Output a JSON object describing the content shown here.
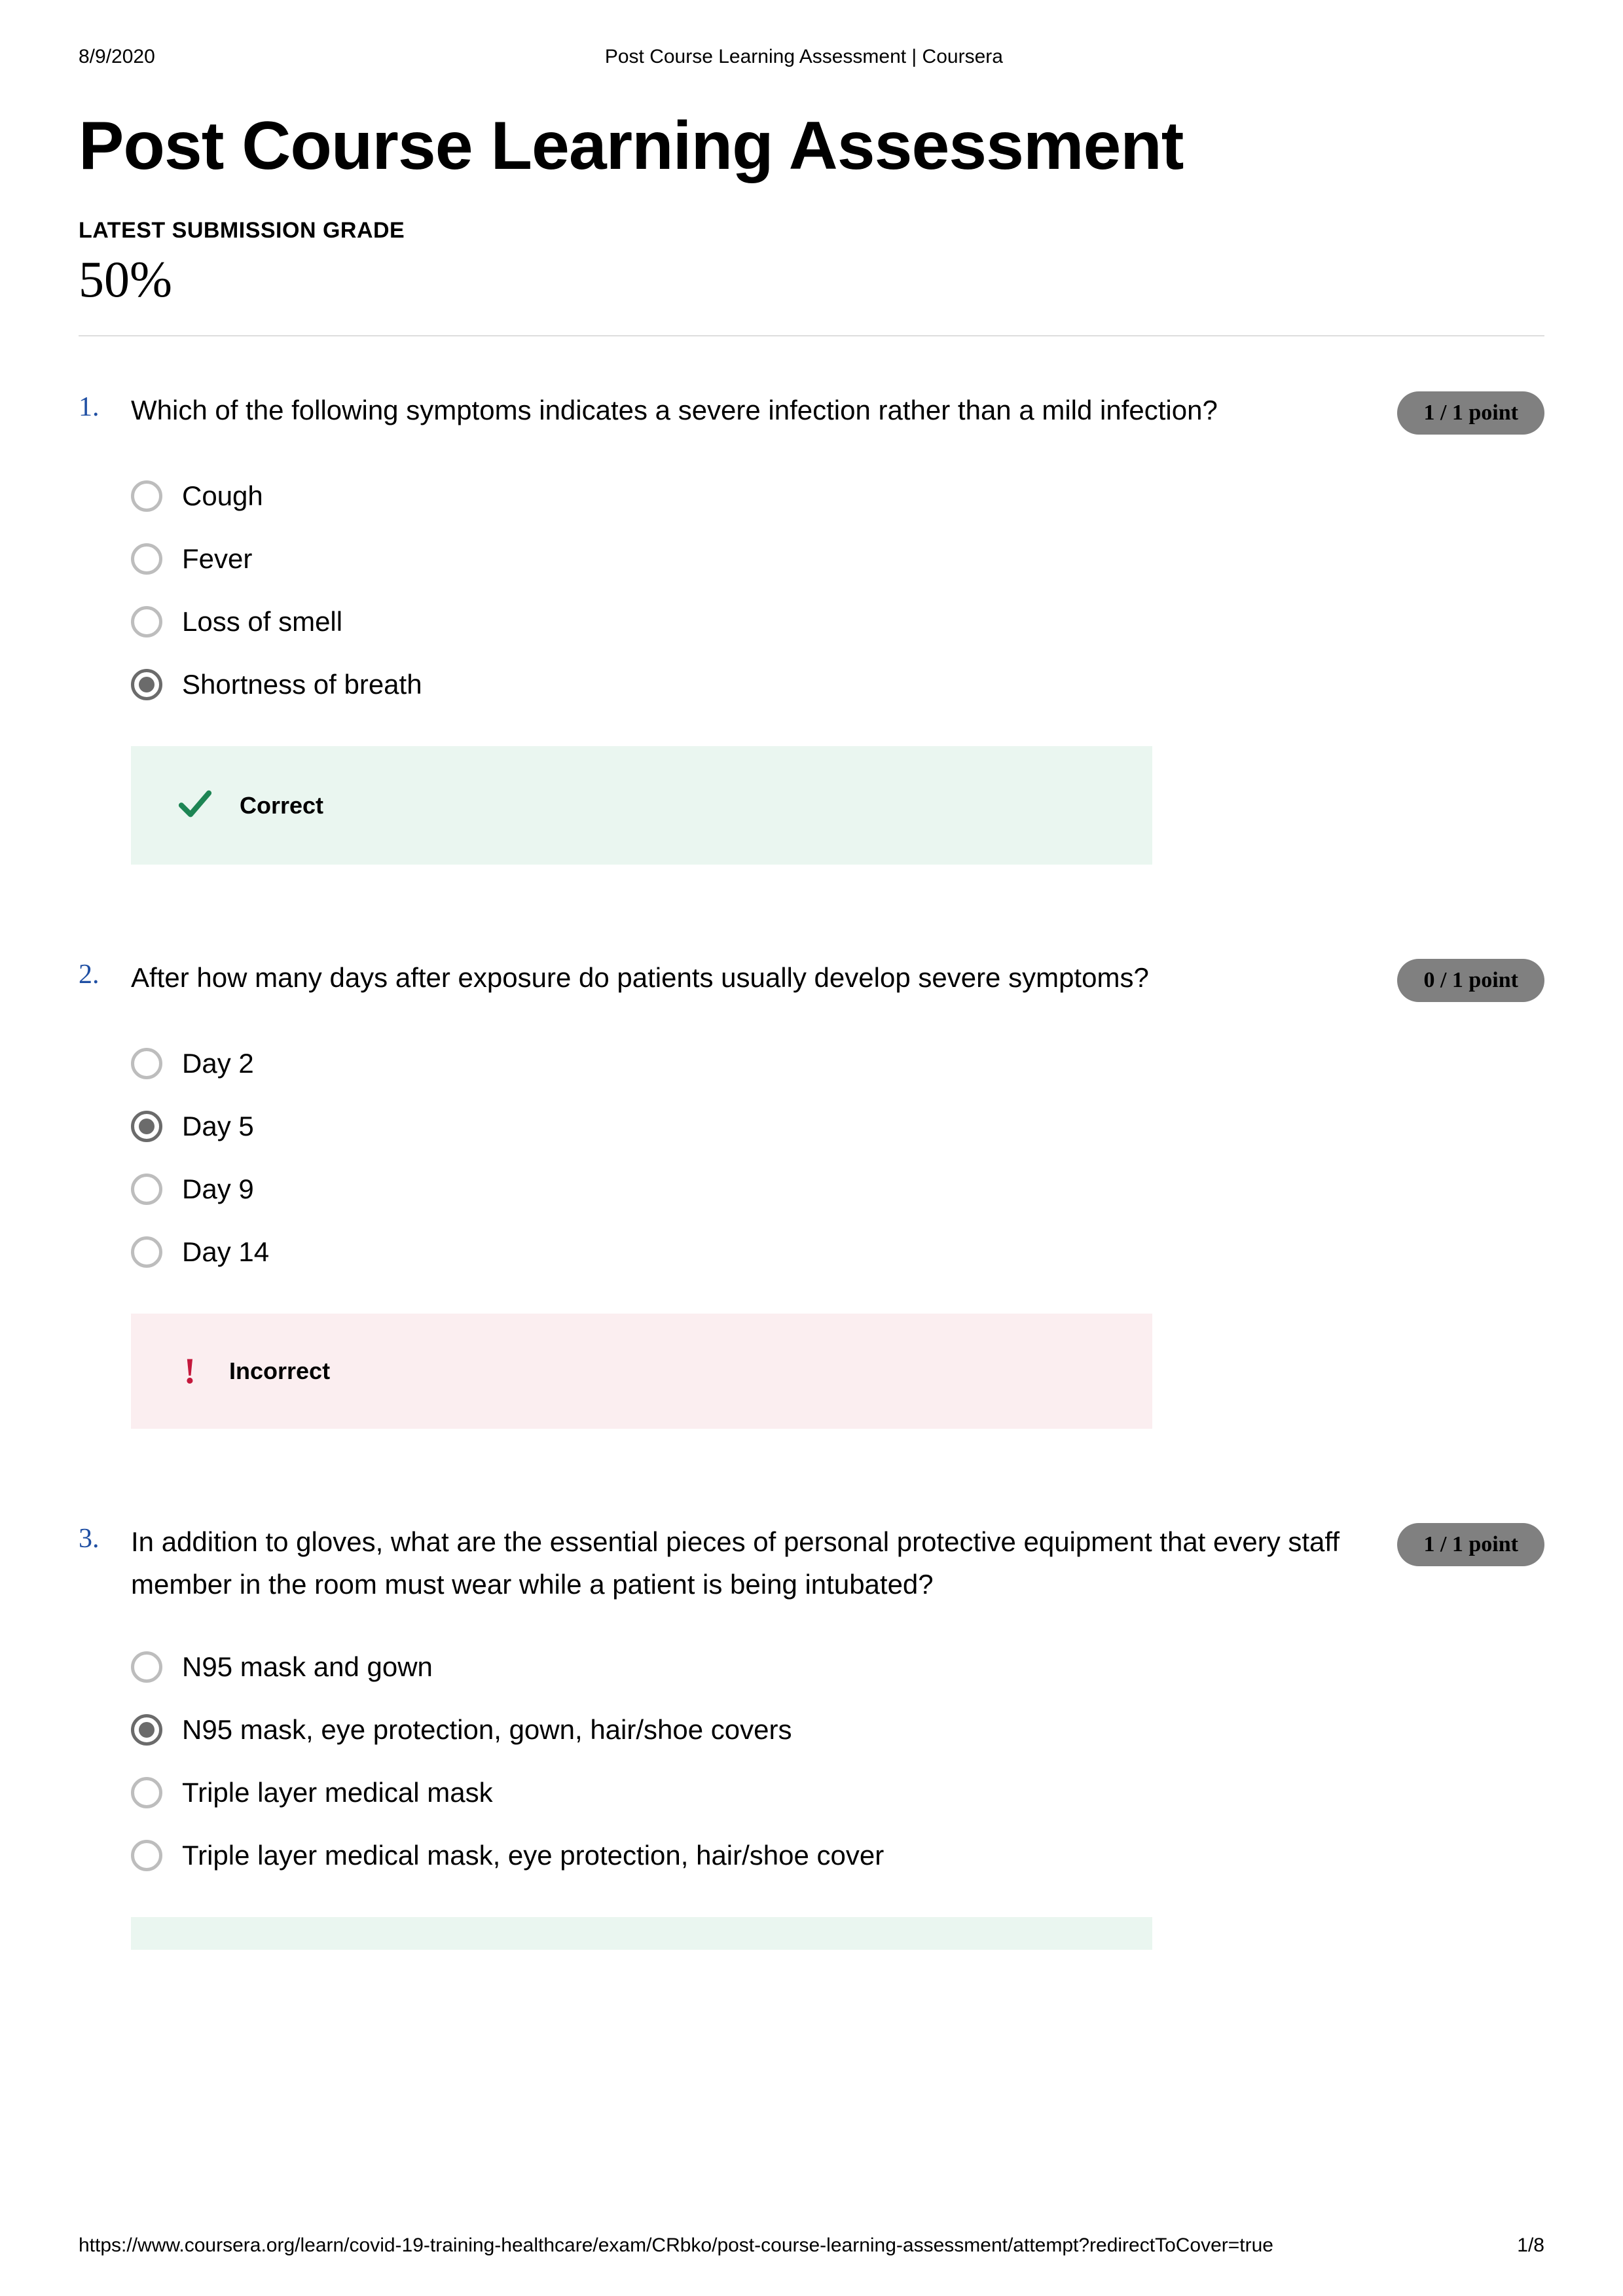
{
  "print": {
    "date": "8/9/2020",
    "header_title": "Post Course Learning Assessment | Coursera",
    "footer_url": "https://www.coursera.org/learn/covid-19-training-healthcare/exam/CRbko/post-course-learning-assessment/attempt?redirectToCover=true",
    "page_indicator": "1/8"
  },
  "page": {
    "title": "Post Course Learning Assessment",
    "grade_label": "LATEST SUBMISSION GRADE",
    "grade_value": "50%"
  },
  "feedback_labels": {
    "correct": "Correct",
    "incorrect": "Incorrect"
  },
  "questions": [
    {
      "number": "1.",
      "prompt": "Which of the following symptoms indicates a severe infection rather than a mild infection?",
      "points": "1 / 1 point",
      "options": [
        {
          "label": "Cough",
          "selected": false
        },
        {
          "label": "Fever",
          "selected": false
        },
        {
          "label": "Loss of smell",
          "selected": false
        },
        {
          "label": "Shortness of breath",
          "selected": true
        }
      ],
      "feedback": "correct"
    },
    {
      "number": "2.",
      "prompt": "After how many days after exposure do patients usually develop severe symptoms?",
      "points": "0 / 1 point",
      "options": [
        {
          "label": "Day 2",
          "selected": false
        },
        {
          "label": "Day 5",
          "selected": true
        },
        {
          "label": "Day 9",
          "selected": false
        },
        {
          "label": "Day 14",
          "selected": false
        }
      ],
      "feedback": "incorrect"
    },
    {
      "number": "3.",
      "prompt": "In addition to gloves, what are the essential pieces of personal protective equipment that every staff member in the room must wear while a patient is being intubated?",
      "points": "1 / 1 point",
      "options": [
        {
          "label": "N95 mask and gown",
          "selected": false
        },
        {
          "label": "N95 mask, eye protection, gown, hair/shoe covers",
          "selected": true
        },
        {
          "label": "Triple layer medical mask",
          "selected": false
        },
        {
          "label": "Triple layer medical mask, eye protection, hair/shoe cover",
          "selected": false
        }
      ],
      "feedback": "partial-correct"
    }
  ]
}
